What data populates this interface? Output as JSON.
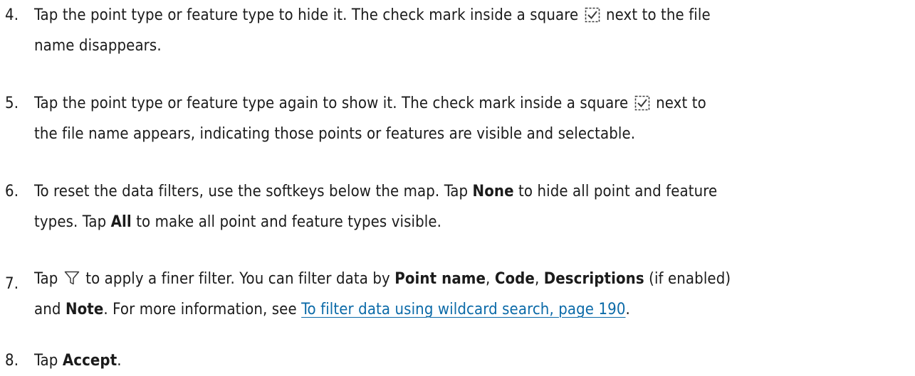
{
  "steps": [
    {
      "number": "4.",
      "line1_before": "Tap the point type or feature type to hide it. The check mark inside a square",
      "line1_after": "next to the file",
      "line2": "name disappears."
    },
    {
      "number": "5.",
      "line1_before": "Tap the point type or feature type again to show it. The check mark inside a square",
      "line1_after": "next to",
      "line2": "the file name appears, indicating those points or features are visible and selectable."
    },
    {
      "number": "6.",
      "line1_a": "To reset the data filters, use the softkeys below the map. Tap ",
      "line1_none": "None",
      "line1_b": " to hide all point and feature",
      "line2_a": "types. Tap ",
      "line2_all": "All",
      "line2_b": " to make all point and feature types visible."
    },
    {
      "number": "7.",
      "line1_a": "Tap",
      "line1_b": " to apply a finer filter. You can filter data by ",
      "point_name": "Point name",
      "sep1": ", ",
      "code": "Code",
      "sep2": ", ",
      "descriptions": "Descriptions",
      "if_enabled": " (if enabled)",
      "line2_and": "and ",
      "note": "Note",
      "line2_mid": ". For more information, see ",
      "link_text": "To filter data using wildcard search, page 190",
      "line2_end": "."
    },
    {
      "number": "8.",
      "text_a": "Tap ",
      "accept": "Accept",
      "text_end": "."
    }
  ],
  "icons": {
    "checkbox_icon": "check-mark-in-dashed-square",
    "filter_icon": "funnel-filter"
  },
  "colors": {
    "text": "#1b1b1b",
    "link": "#0b6aa8",
    "icon_check": "#3a3a3a"
  }
}
